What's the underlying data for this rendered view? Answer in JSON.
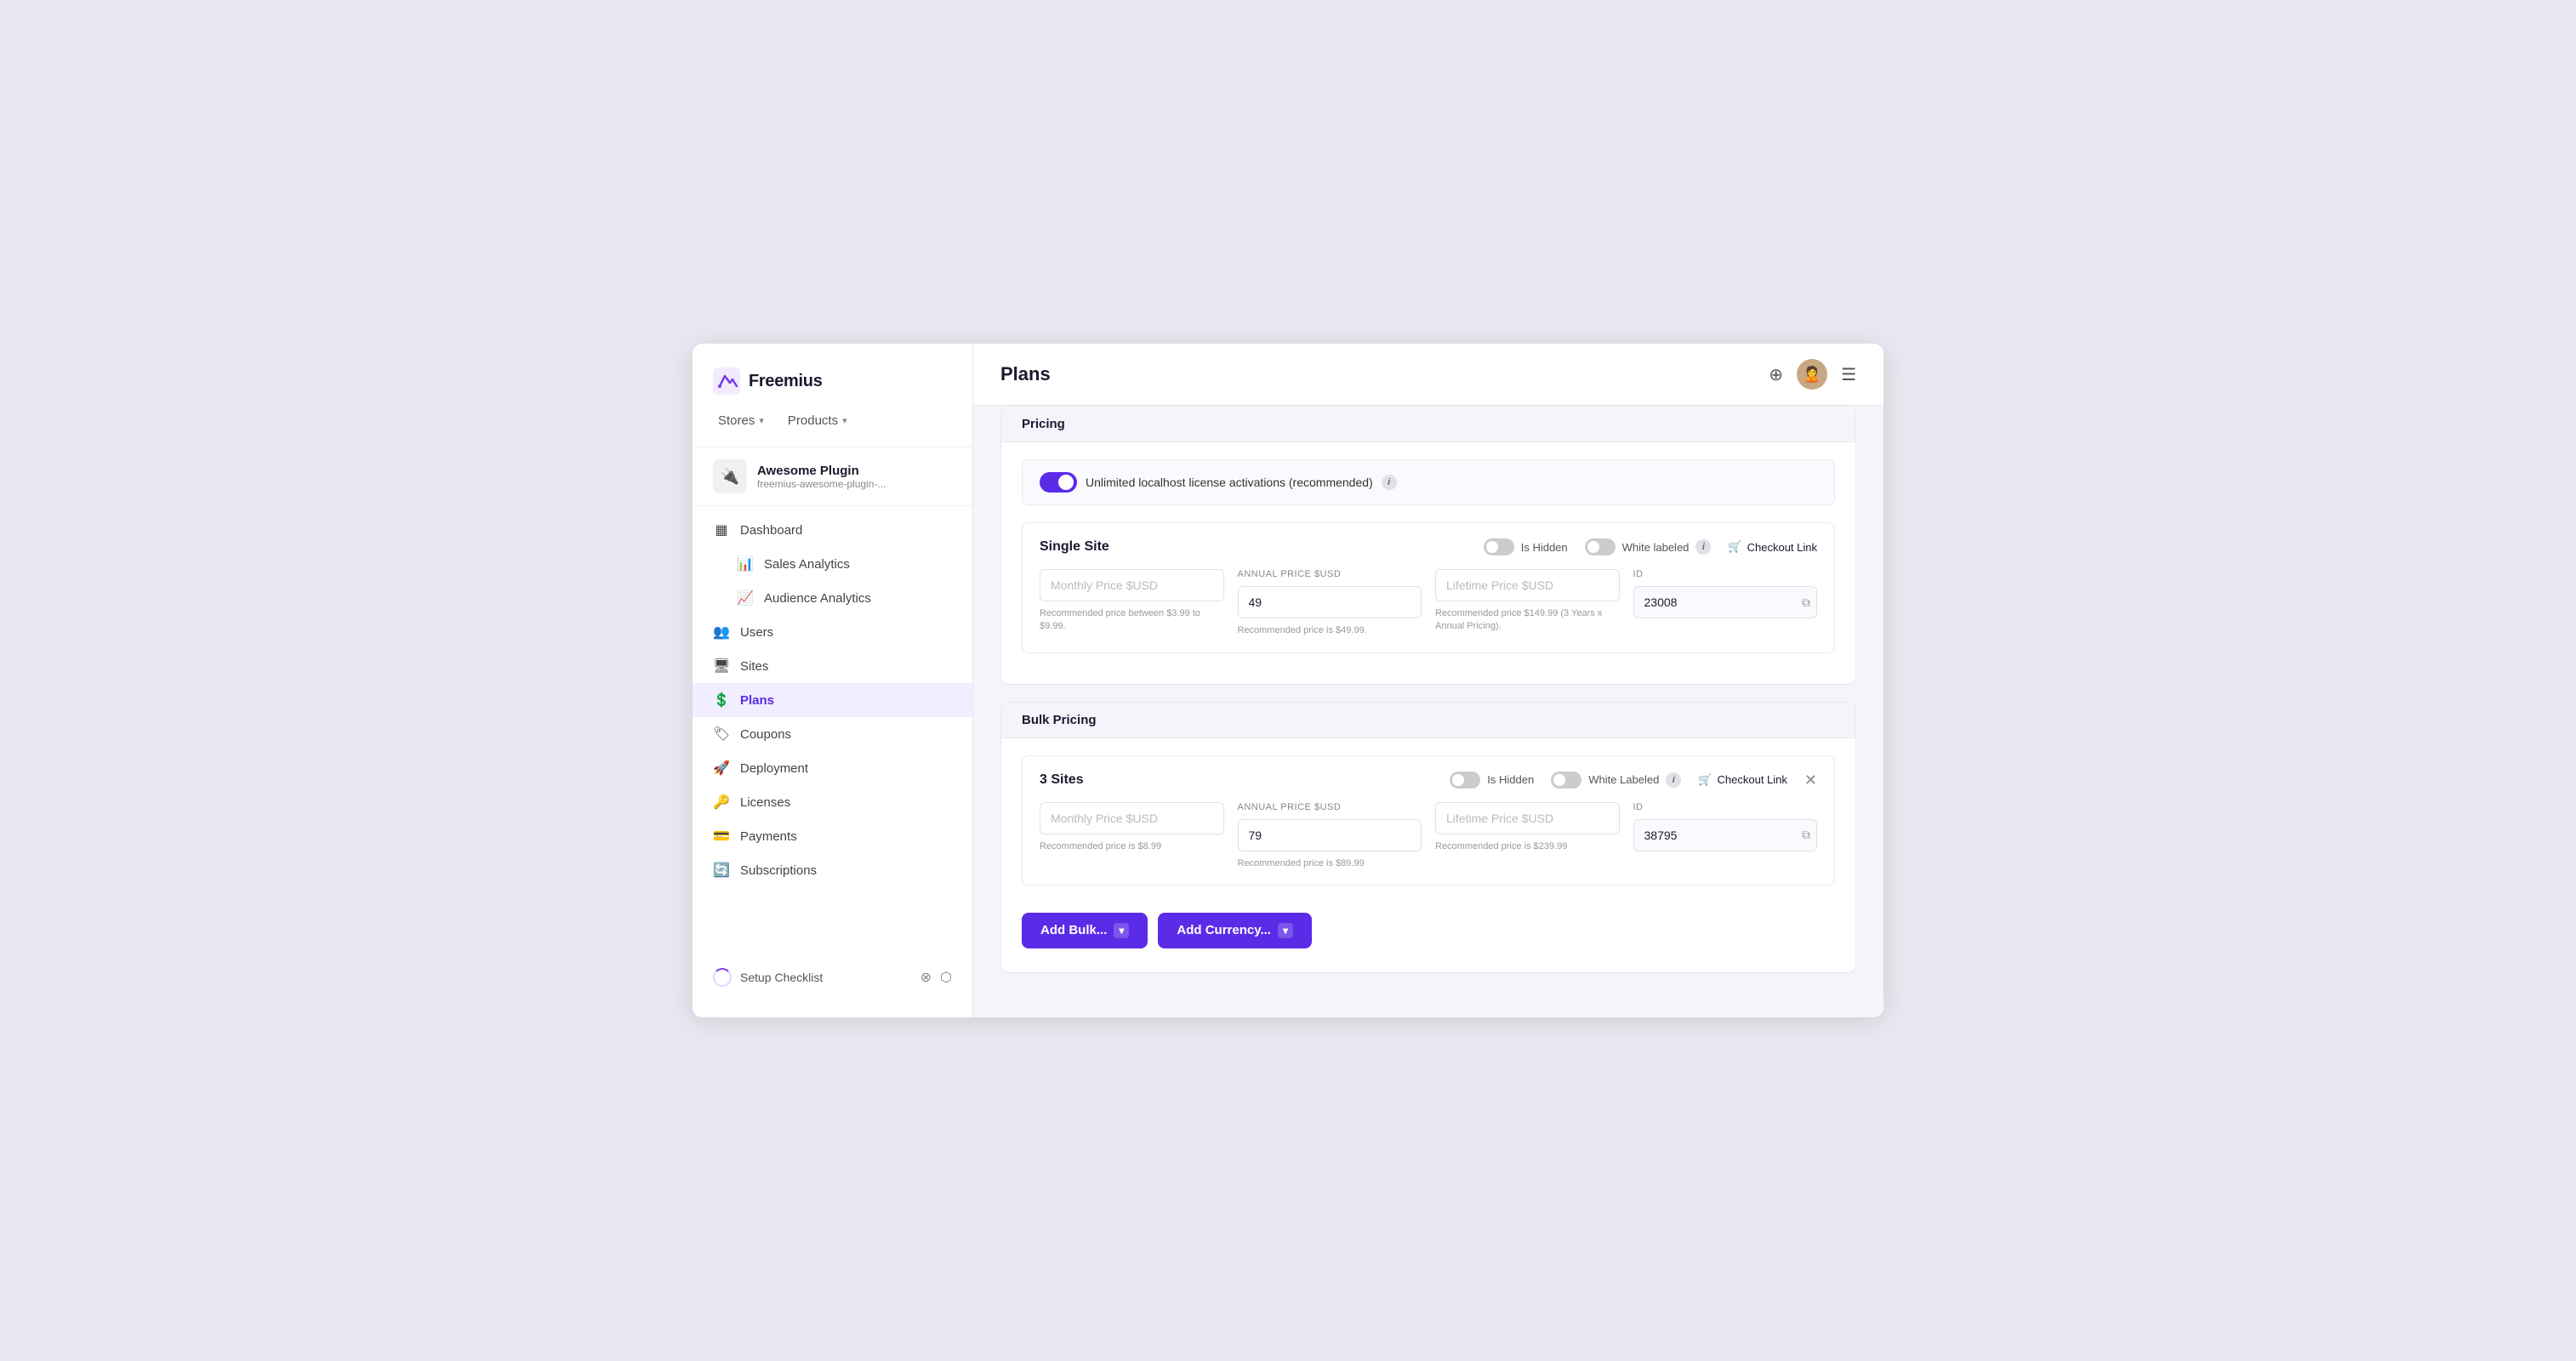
{
  "app": {
    "logo_text": "Freemius",
    "window_title": "Plans"
  },
  "sidebar": {
    "stores_label": "Stores",
    "products_label": "Products",
    "plugin": {
      "name": "Awesome Plugin",
      "slug": "freemius-awesome-plugin-..."
    },
    "nav_items": [
      {
        "id": "dashboard",
        "label": "Dashboard",
        "icon": "▦",
        "active": false,
        "sub": false
      },
      {
        "id": "sales-analytics",
        "label": "Sales Analytics",
        "icon": "📊",
        "active": false,
        "sub": true
      },
      {
        "id": "audience-analytics",
        "label": "Audience Analytics",
        "icon": "📈",
        "active": false,
        "sub": true
      },
      {
        "id": "users",
        "label": "Users",
        "icon": "👥",
        "active": false,
        "sub": false
      },
      {
        "id": "sites",
        "label": "Sites",
        "icon": "🖥",
        "active": false,
        "sub": false
      },
      {
        "id": "plans",
        "label": "Plans",
        "icon": "💲",
        "active": true,
        "sub": false
      },
      {
        "id": "coupons",
        "label": "Coupons",
        "icon": "🏷",
        "active": false,
        "sub": false
      },
      {
        "id": "deployment",
        "label": "Deployment",
        "icon": "🚀",
        "active": false,
        "sub": false
      },
      {
        "id": "licenses",
        "label": "Licenses",
        "icon": "🔑",
        "active": false,
        "sub": false
      },
      {
        "id": "payments",
        "label": "Payments",
        "icon": "💳",
        "active": false,
        "sub": false
      },
      {
        "id": "subscriptions",
        "label": "Subscriptions",
        "icon": "🔄",
        "active": false,
        "sub": false
      }
    ],
    "setup_checklist_label": "Setup Checklist"
  },
  "header": {
    "title": "Plans",
    "add_btn_label": "⊕",
    "menu_btn_label": "☰"
  },
  "pricing_section": {
    "label": "Pricing",
    "unlimited_toggle_label": "Unlimited localhost license activations (recommended)",
    "unlimited_toggle_on": true,
    "info_icon": "i"
  },
  "single_site": {
    "title": "Single Site",
    "is_hidden_label": "Is Hidden",
    "white_labeled_label": "White labeled",
    "checkout_link_label": "Checkout Link",
    "is_hidden_on": false,
    "white_labeled_on": false,
    "annual_price_label": "Annual Price $USD",
    "annual_price_value": "49",
    "monthly_price_placeholder": "Monthly Price $USD",
    "lifetime_price_placeholder": "Lifetime Price $USD",
    "id_label": "ID",
    "id_value": "23008",
    "monthly_hint": "Recommended price between $3.99 to $9.99.",
    "annual_hint": "Recommended price is $49.99.",
    "lifetime_hint": "Recommended price $149.99 (3 Years x Annual Pricing).",
    "info_icon": "i"
  },
  "bulk_pricing": {
    "label": "Bulk Pricing",
    "three_sites": {
      "title": "3 Sites",
      "is_hidden_label": "Is Hidden",
      "white_labeled_label": "White Labeled",
      "checkout_link_label": "Checkout Link",
      "is_hidden_on": false,
      "white_labeled_on": false,
      "annual_price_label": "Annual Price $USD",
      "annual_price_value": "79",
      "monthly_price_placeholder": "Monthly Price $USD",
      "lifetime_price_placeholder": "Lifetime Price $USD",
      "id_label": "ID",
      "id_value": "38795",
      "monthly_hint": "Recommended price is $8.99",
      "annual_hint": "Recommended price is $89.99",
      "lifetime_hint": "Recommended price is $239.99",
      "info_icon": "i"
    }
  },
  "actions": {
    "add_bulk_label": "Add Bulk...",
    "add_currency_label": "Add Currency..."
  }
}
